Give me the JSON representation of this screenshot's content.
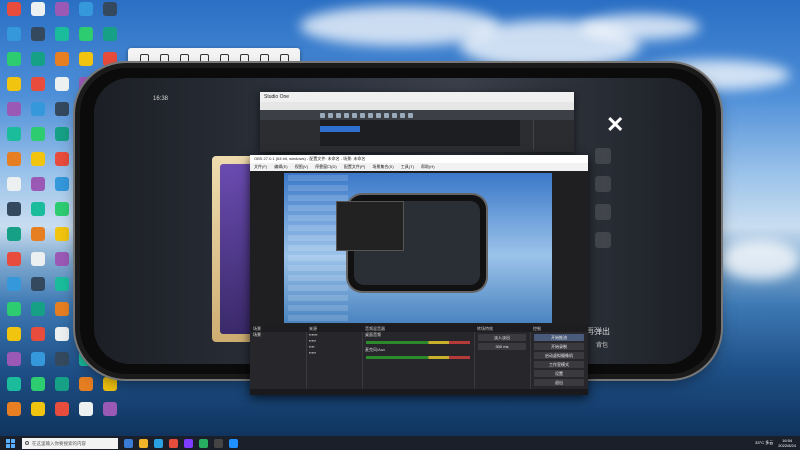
{
  "phone_overlay": {
    "time_label": "16:38",
    "popup_hint": "再弹出",
    "bottom_right_label": "背包"
  },
  "editor_window": {
    "title": "Studio One"
  },
  "obs": {
    "title": "OBS 27.0.1 (64 bit, windows) - 配置文件: 未命名 - 场景: 未命名",
    "menu": [
      "文件(F)",
      "编辑(E)",
      "视图(V)",
      "停靠窗口(D)",
      "配置文件(P)",
      "场景集合(S)",
      "工具(T)",
      "帮助(H)"
    ],
    "docks": {
      "scenes": "场景",
      "sources": "来源",
      "mixer": "音频混音器",
      "transitions": "转场特效",
      "controls": "控制"
    },
    "scene_item": "场景",
    "mixer_rows": [
      "桌面音频",
      "麦克风/Aux"
    ],
    "transition_items": [
      "淡入淡出",
      "300 ms"
    ],
    "controls": [
      "开始推流",
      "开始录制",
      "启动虚拟摄像机",
      "工作室模式",
      "设置",
      "退出"
    ],
    "active_control": "开始推流"
  },
  "taskbar": {
    "search_placeholder": "在这里输入你要搜索的内容",
    "weather": "33°C 多云",
    "time": "16:54",
    "date": "2022/8/24"
  }
}
